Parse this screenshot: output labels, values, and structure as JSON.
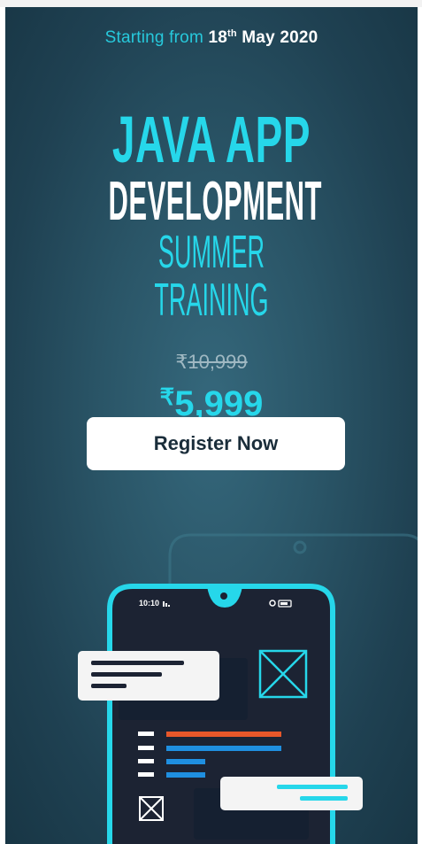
{
  "banner": {
    "start_prefix": "Starting from",
    "start_day": "18",
    "start_suffix": "th",
    "start_month_year": "May 2020",
    "title_line1": "JAVA APP",
    "title_line2": "DEVELOPMENT",
    "title_line3": "SUMMER TRAINING",
    "currency_symbol": "₹",
    "old_price": "10,999",
    "new_price": "5,999",
    "register_label": "Register Now"
  },
  "phone": {
    "status_time": "10:10"
  },
  "colors": {
    "accent": "#26d7ea",
    "background": "#2a5567",
    "button": "#ffffff",
    "button_text": "#1a2d3a",
    "bar_orange": "#e8572a",
    "bar_blue": "#1f8fe0"
  },
  "icons": [
    "signal-icon",
    "battery-icon",
    "image-placeholder-icon"
  ]
}
